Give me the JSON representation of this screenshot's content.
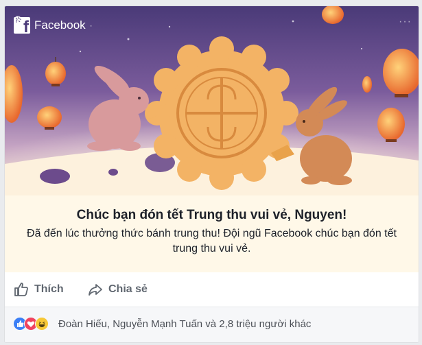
{
  "post": {
    "source_name": "Facebook",
    "separator": "·",
    "privacy_icon": "globe-icon",
    "more_icon": "more-options-icon",
    "more_label": "···"
  },
  "greeting": {
    "title": "Chúc bạn đón tết Trung thu vui vẻ, Nguyen!",
    "message": "Đã đến lúc thưởng thức bánh trung thu! Đội ngũ Facebook chúc bạn đón tết trung thu vui vẻ."
  },
  "actions": {
    "like_label": "Thích",
    "like_icon": "thumbs-up-icon",
    "share_label": "Chia sẻ",
    "share_icon": "share-arrow-icon"
  },
  "reactions": {
    "icons": [
      "like-reaction-icon",
      "love-reaction-icon",
      "haha-reaction-icon"
    ],
    "summary": "Đoàn Hiếu, Nguyễn Mạnh Tuấn và 2,8 triệu người khác"
  },
  "colors": {
    "sky_top": "#4a3a78",
    "sky_mid": "#9b7ab6",
    "mooncake": "#f3b365",
    "rabbit_left": "#d89a9c",
    "rabbit_right": "#d38a56",
    "lantern": "#f07a3a",
    "caption_bg": "#fff8e8",
    "like_blue": "#3b7ff6",
    "love_red": "#f0435f",
    "haha_yellow": "#f7c836"
  }
}
